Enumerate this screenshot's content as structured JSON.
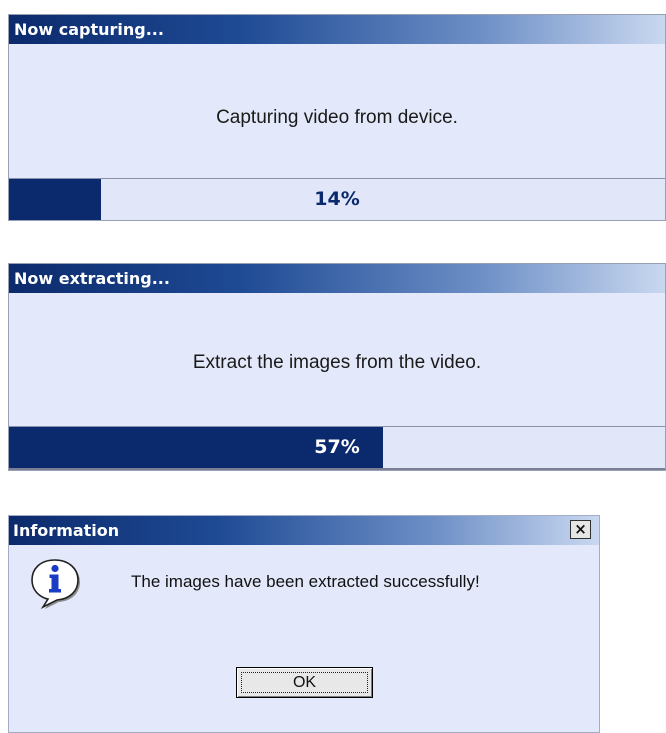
{
  "capture_dialog": {
    "title": "Now capturing...",
    "message": "Capturing video from device.",
    "progress_percent": 14,
    "progress_label": "14%"
  },
  "extract_dialog": {
    "title": "Now extracting...",
    "message": "Extract the images from the video.",
    "progress_percent": 57,
    "progress_label": "57%"
  },
  "info_dialog": {
    "title": "Information",
    "close_icon": "close-icon",
    "icon": "info-icon",
    "message": "The images have been extracted successfully!",
    "ok_label": "OK"
  },
  "colors": {
    "titlebar_dark": "#0c2a6c",
    "titlebar_light": "#c9d8f0",
    "dialog_bg": "#e3e8fa",
    "progress_fill": "#0b2a6e"
  }
}
